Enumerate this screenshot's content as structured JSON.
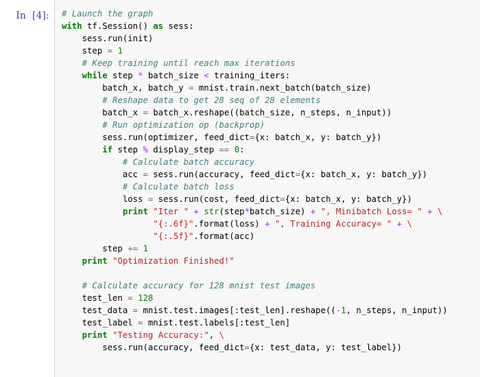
{
  "cell": {
    "prompt_label": "In  [4]:",
    "execution_count": 4,
    "cell_type": "code",
    "language": "python"
  },
  "colors": {
    "prompt": "#303f9f",
    "cell_background": "#f7f7f7",
    "page_background": "#ffffff",
    "border": "#cfcfcf",
    "keyword": "#008000",
    "comment": "#408080",
    "string": "#ba2121",
    "number": "#008000",
    "operator": "#aa22ff",
    "operator_plain": "#666666",
    "name": "#000000"
  },
  "code": {
    "lines": [
      "# Launch the graph",
      "with tf.Session() as sess:",
      "    sess.run(init)",
      "    step = 1",
      "    # Keep training until reach max iterations",
      "    while step * batch_size < training_iters:",
      "        batch_x, batch_y = mnist.train.next_batch(batch_size)",
      "        # Reshape data to get 28 seq of 28 elements",
      "        batch_x = batch_x.reshape((batch_size, n_steps, n_input))",
      "        # Run optimization op (backprop)",
      "        sess.run(optimizer, feed_dict={x: batch_x, y: batch_y})",
      "        if step % display_step == 0:",
      "            # Calculate batch accuracy",
      "            acc = sess.run(accuracy, feed_dict={x: batch_x, y: batch_y})",
      "            # Calculate batch loss",
      "            loss = sess.run(cost, feed_dict={x: batch_x, y: batch_y})",
      "            print \"Iter \" + str(step*batch_size) + \", Minibatch Loss= \" + \\",
      "                  \"{:.6f}\".format(loss) + \", Training Accuracy= \" + \\",
      "                  \"{:.5f}\".format(acc)",
      "        step += 1",
      "    print \"Optimization Finished!\"",
      "",
      "    # Calculate accuracy for 128 mnist test images",
      "    test_len = 128",
      "    test_data = mnist.test.images[:test_len].reshape((-1, n_steps, n_input))",
      "    test_label = mnist.test.labels[:test_len]",
      "    print \"Testing Accuracy:\", \\",
      "        sess.run(accuracy, feed_dict={x: test_data, y: test_label})"
    ],
    "comments": [
      "# Launch the graph",
      "# Keep training until reach max iterations",
      "# Reshape data to get 28 seq of 28 elements",
      "# Run optimization op (backprop)",
      "# Calculate batch accuracy",
      "# Calculate batch loss",
      "# Calculate accuracy for 128 mnist test images"
    ],
    "keywords": [
      "with",
      "as",
      "while",
      "if",
      "print"
    ],
    "strings": [
      "\"Iter \"",
      "\", Minibatch Loss= \"",
      "\"{:.6f}\"",
      "\", Training Accuracy= \"",
      "\"{:.5f}\"",
      "\"Optimization Finished!\"",
      "\"Testing Accuracy:\""
    ],
    "numbers": [
      "1",
      "0",
      "1",
      "128",
      "128",
      "-1"
    ],
    "line_count": 28
  }
}
